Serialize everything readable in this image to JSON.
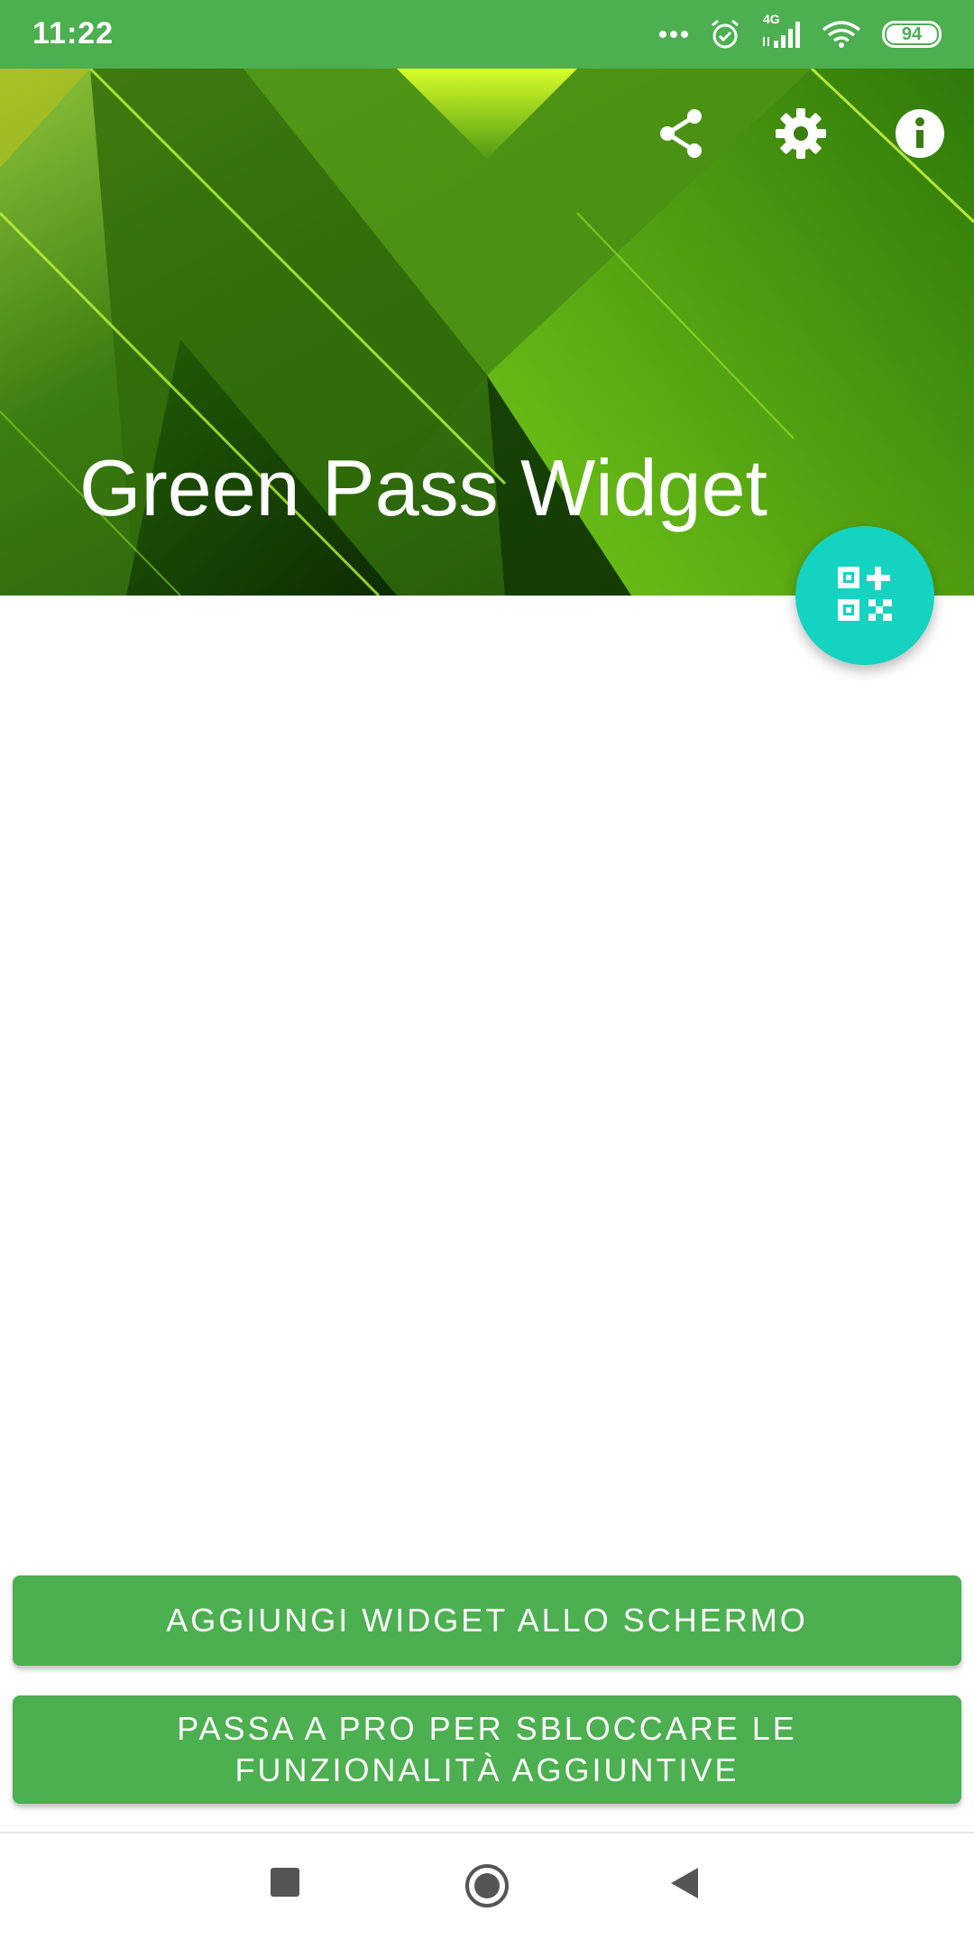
{
  "status_bar": {
    "time": "11:22",
    "network": "4G",
    "battery": "94",
    "icons": [
      "dots-icon",
      "alarm-icon",
      "signal-icon",
      "wifi-icon",
      "battery-icon"
    ]
  },
  "header": {
    "title": "Green Pass Widget",
    "actions": [
      "share-icon",
      "settings-icon",
      "info-icon"
    ]
  },
  "fab": {
    "icon": "qr-add-icon"
  },
  "buttons": {
    "add_widget": "AGGIUNGI WIDGET ALLO SCHERMO",
    "pro_line1": "PASSA A PRO PER SBLOCCARE LE",
    "pro_line2": "FUNZIONALITÀ AGGIUNTIVE"
  },
  "nav": [
    "recents-icon",
    "home-icon",
    "back-icon"
  ],
  "colors": {
    "primary": "#4caf50",
    "fab": "#14d3c1",
    "header_bg": "#2d6a0a"
  }
}
